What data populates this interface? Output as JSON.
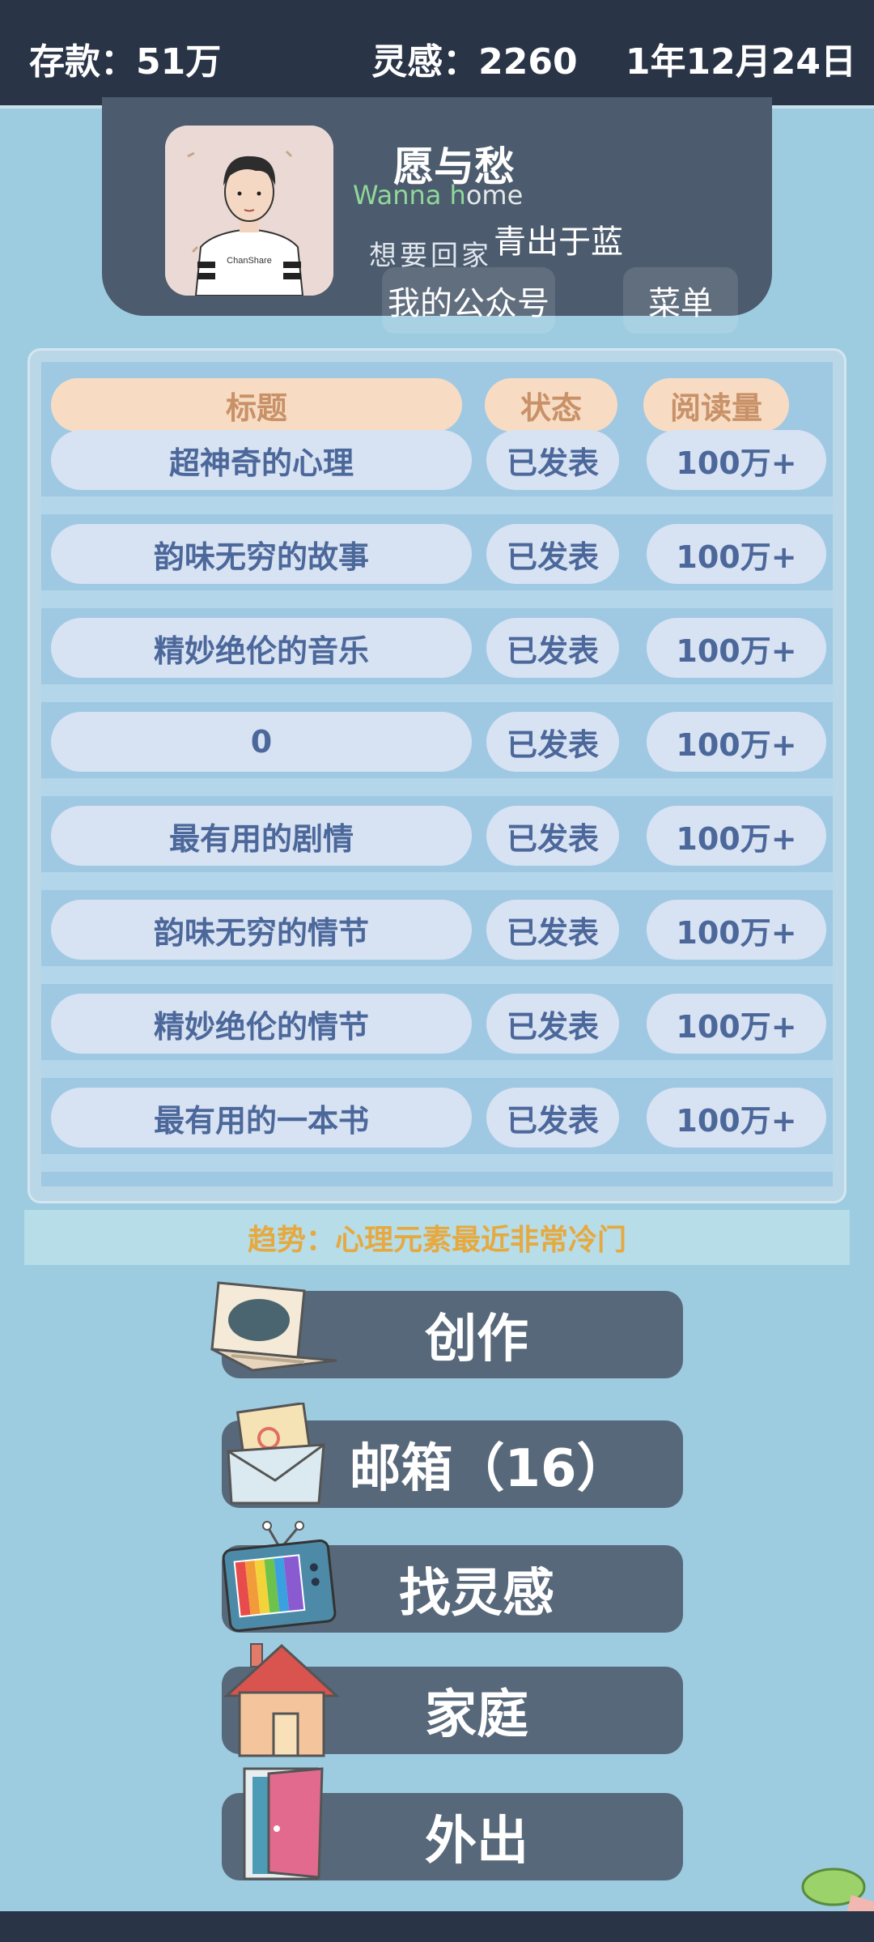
{
  "status": {
    "savings_label": "存款：",
    "savings_value": "51万",
    "inspiration_label": "灵感：",
    "inspiration_value": "2260",
    "date": "1年12月24日"
  },
  "profile": {
    "name": "愿与愁",
    "motto_en_prefix": "Wanna h",
    "motto_en_suffix": "ome",
    "motto_cn": "想要回家",
    "motto_right": "青出于蓝",
    "official_account_button": "我的公众号",
    "menu_button": "菜单",
    "avatar_shirt_text": "ChanShare"
  },
  "table": {
    "headers": [
      "标题",
      "状态",
      "阅读量"
    ],
    "rows": [
      {
        "title": "超神奇的心理",
        "status": "已发表",
        "reads": "100万+"
      },
      {
        "title": "韵味无穷的故事",
        "status": "已发表",
        "reads": "100万+"
      },
      {
        "title": "精妙绝伦的音乐",
        "status": "已发表",
        "reads": "100万+"
      },
      {
        "title": "0",
        "status": "已发表",
        "reads": "100万+"
      },
      {
        "title": "最有用的剧情",
        "status": "已发表",
        "reads": "100万+"
      },
      {
        "title": "韵味无穷的情节",
        "status": "已发表",
        "reads": "100万+"
      },
      {
        "title": "精妙绝伦的情节",
        "status": "已发表",
        "reads": "100万+"
      },
      {
        "title": "最有用的一本书",
        "status": "已发表",
        "reads": "100万+"
      }
    ]
  },
  "trend": "趋势：心理元素最近非常冷门",
  "actions": {
    "create": "创作",
    "mailbox": "邮箱（16）",
    "inspiration": "找灵感",
    "family": "家庭",
    "go_out": "外出"
  },
  "icons": [
    "laptop-icon",
    "mail-icon",
    "tv-icon",
    "house-icon",
    "door-icon",
    "leaf-icon"
  ]
}
